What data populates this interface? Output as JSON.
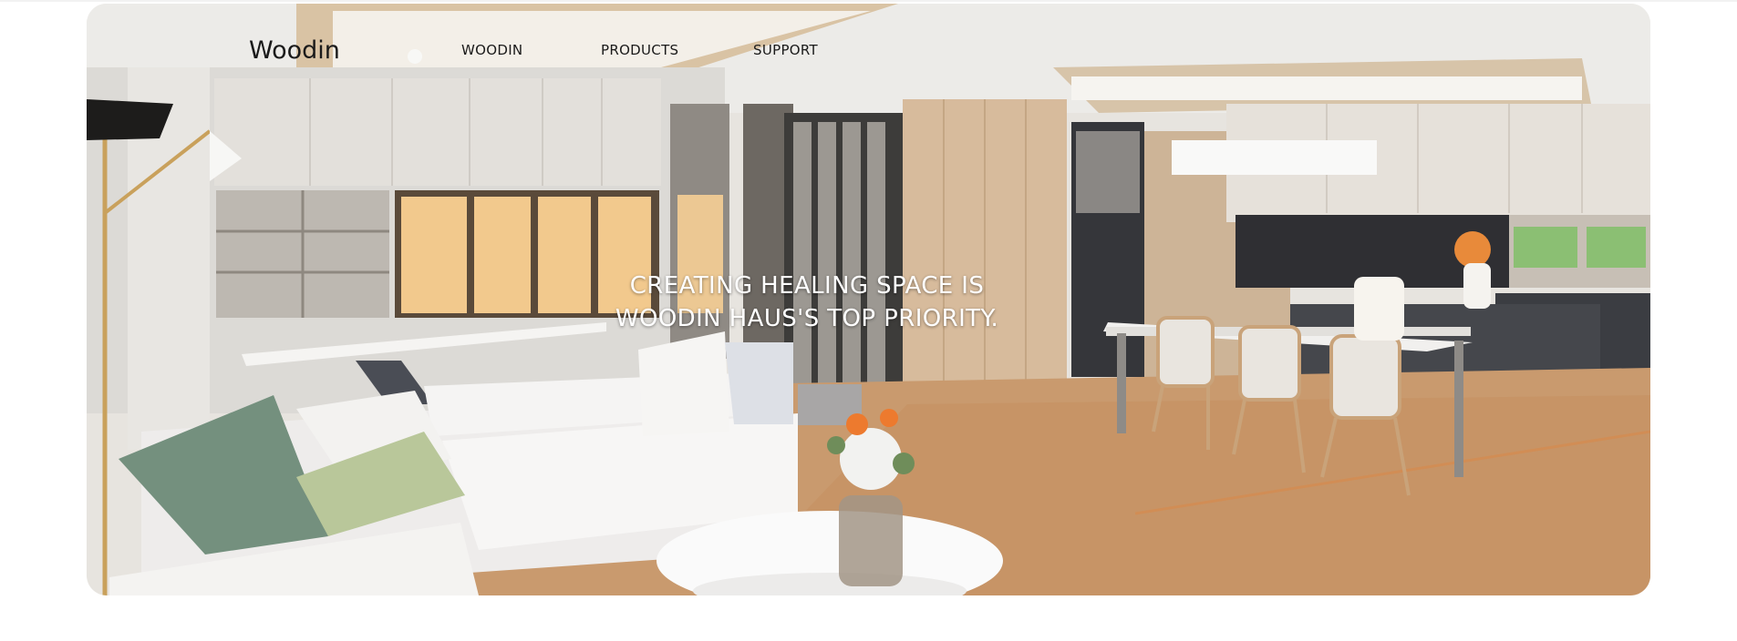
{
  "header": {
    "brand": "Woodin",
    "nav": [
      {
        "label": "WOODIN"
      },
      {
        "label": "PRODUCTS"
      },
      {
        "label": "SUPPORT"
      }
    ]
  },
  "hero": {
    "tagline_line1": "CREATING HEALING SPACE IS",
    "tagline_line2": "WOODIN HAUS'S TOP PRIORITY.",
    "image_subject": "modern living room and kitchen interior"
  },
  "colors": {
    "page_background": "#ffffff",
    "tagline": "#ffffff",
    "nav_text": "#1a1a1a",
    "wood_floor": "#c99a6e"
  }
}
